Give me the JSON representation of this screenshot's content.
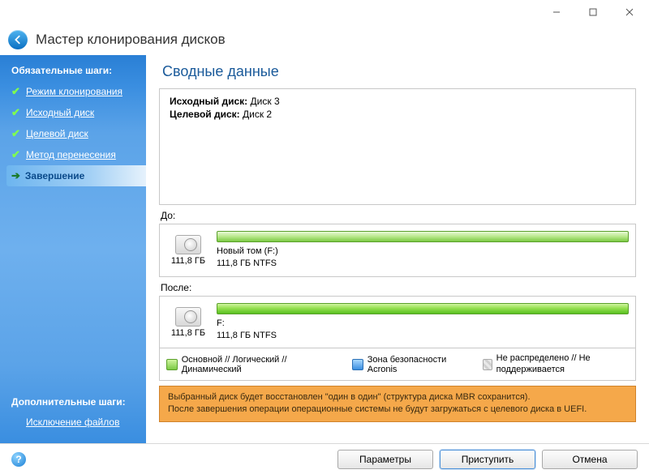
{
  "window": {
    "title": "Мастер клонирования дисков"
  },
  "sidebar": {
    "required_heading": "Обязательные шаги:",
    "optional_heading": "Дополнительные шаги:",
    "steps": [
      {
        "label": "Режим клонирования"
      },
      {
        "label": "Исходный диск"
      },
      {
        "label": "Целевой диск"
      },
      {
        "label": "Метод перенесения"
      },
      {
        "label": "Завершение"
      }
    ],
    "optional": [
      {
        "label": "Исключение файлов"
      }
    ]
  },
  "main": {
    "title": "Сводные данные",
    "source_label": "Исходный диск:",
    "source_value": "Диск 3",
    "target_label": "Целевой диск:",
    "target_value": "Диск 2",
    "before_label": "До:",
    "after_label": "После:",
    "disk_before": {
      "size": "111,8 ГБ",
      "part_name": "Новый том (F:)",
      "part_detail": "111,8 ГБ  NTFS"
    },
    "disk_after": {
      "size": "111,8 ГБ",
      "part_name": "F:",
      "part_detail": "111,8 ГБ  NTFS"
    },
    "legend": {
      "primary": "Основной // Логический // Динамический",
      "acronis": "Зона безопасности Acronis",
      "unalloc": "Не распределено // Не поддерживается"
    },
    "warning_line1": "Выбранный диск будет восстановлен \"один в один\" (структура диска MBR сохранится).",
    "warning_line2": "После завершения операции операционные системы не будут загружаться с целевого диска в UEFI."
  },
  "footer": {
    "options": "Параметры",
    "proceed": "Приступить",
    "cancel": "Отмена"
  }
}
